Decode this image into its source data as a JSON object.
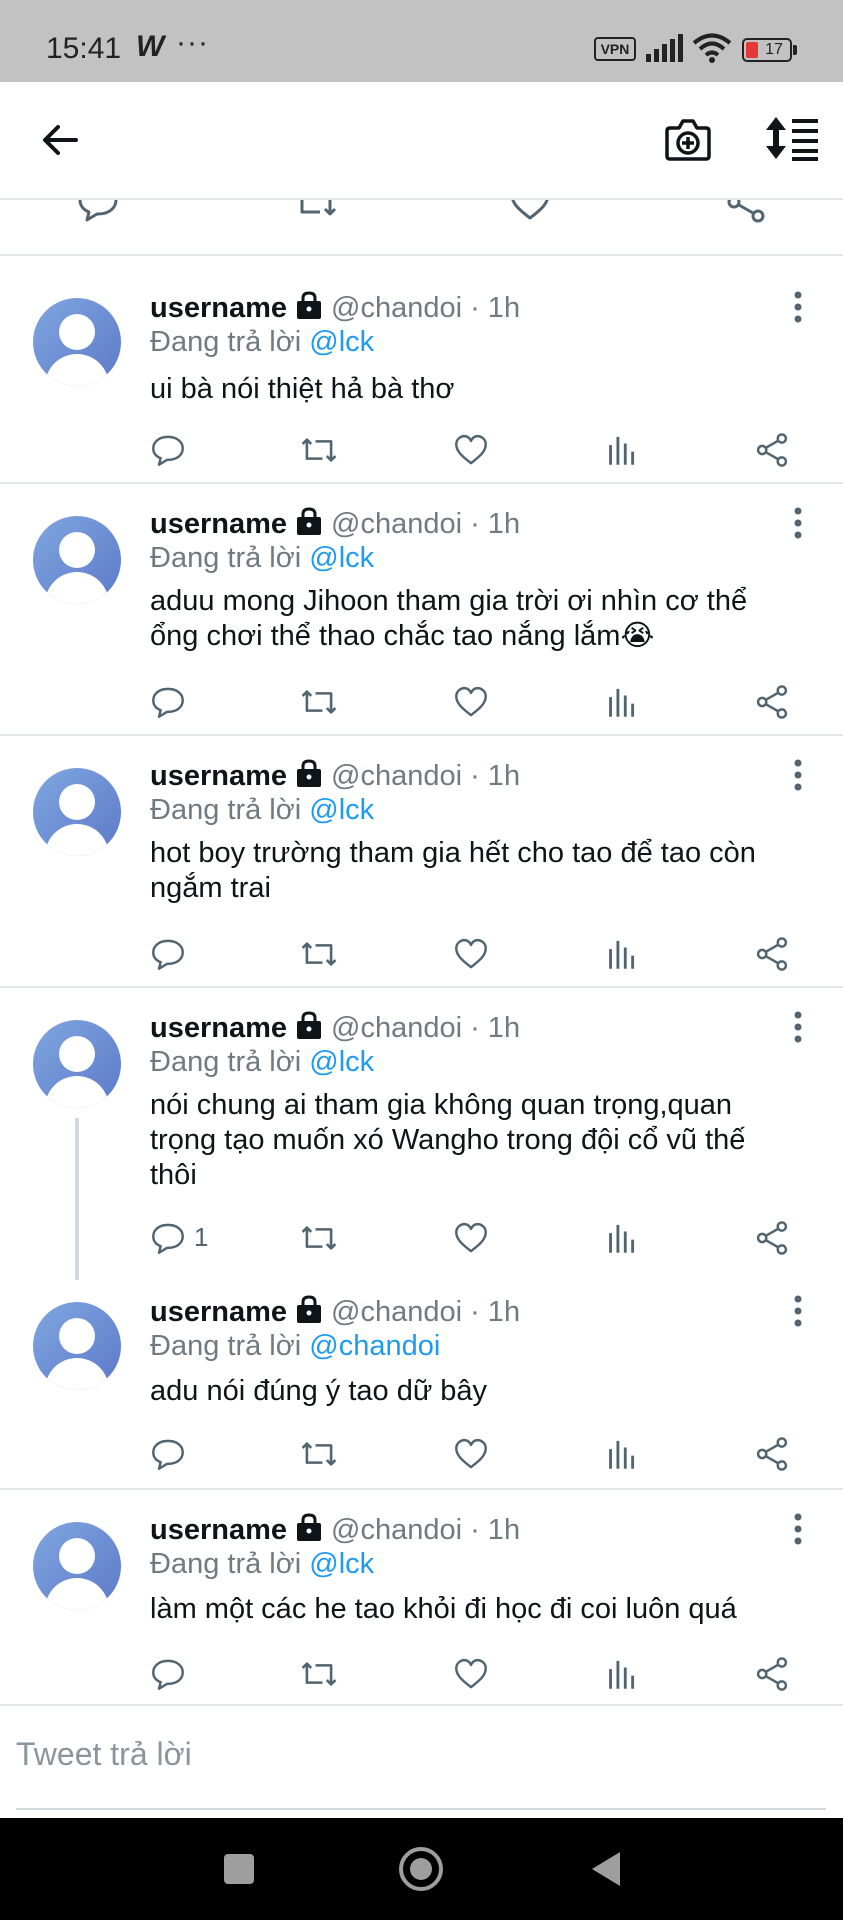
{
  "status_bar": {
    "time": "15:41",
    "app_badge": "W",
    "more": "···",
    "vpn": "VPN",
    "battery": "17",
    "battery_color": "#e53935"
  },
  "top_bar": {
    "back_icon": "arrow-left-icon",
    "camera_icon": "camera-plus-icon",
    "sort_icon": "sort-list-icon"
  },
  "colors": {
    "mention": "#1d9bf0",
    "secondary_text": "#707a82",
    "divider": "#e3e6e9",
    "icon": "#536471"
  },
  "tweets": [
    {
      "username": "username",
      "handle": "@chandoi · 1h",
      "replying_prefix": "Đang trả lời",
      "replying_to": "@lck",
      "text": "ui bà nói thiệt hả bà thơ",
      "reply_count": ""
    },
    {
      "username": "username",
      "handle": "@chandoi · 1h",
      "replying_prefix": "Đang trả lời",
      "replying_to": "@lck",
      "text": "aduu mong Jihoon tham gia trời ơi nhìn cơ thể ổng chơi thể thao chắc tao nắng lắm😭",
      "reply_count": ""
    },
    {
      "username": "username",
      "handle": "@chandoi · 1h",
      "replying_prefix": "Đang trả lời",
      "replying_to": "@lck",
      "text": "hot boy trường tham gia hết cho tao để tao còn ngắm trai",
      "reply_count": ""
    },
    {
      "username": "username",
      "handle": "@chandoi · 1h",
      "replying_prefix": "Đang trả lời",
      "replying_to": "@lck",
      "text": "nói chung ai tham gia không quan trọng,quan trọng tạo muốn xó Wangho trong đội cổ vũ thế thôi",
      "reply_count": "1"
    },
    {
      "username": "username",
      "handle": "@chandoi · 1h",
      "replying_prefix": "Đang trả lời",
      "replying_to": "@chandoi",
      "text": "adu nói đúng ý tao dữ bây",
      "reply_count": ""
    },
    {
      "username": "username",
      "handle": "@chandoi · 1h",
      "replying_prefix": "Đang trả lời",
      "replying_to": "@lck",
      "text": "làm một các he tao khỏi đi học đi coi luôn quá",
      "reply_count": ""
    }
  ],
  "composer": {
    "placeholder": "Tweet trả lời"
  },
  "nav_bar": {
    "recents_icon": "square-icon",
    "home_icon": "circle-icon",
    "back_icon": "triangle-back-icon"
  }
}
